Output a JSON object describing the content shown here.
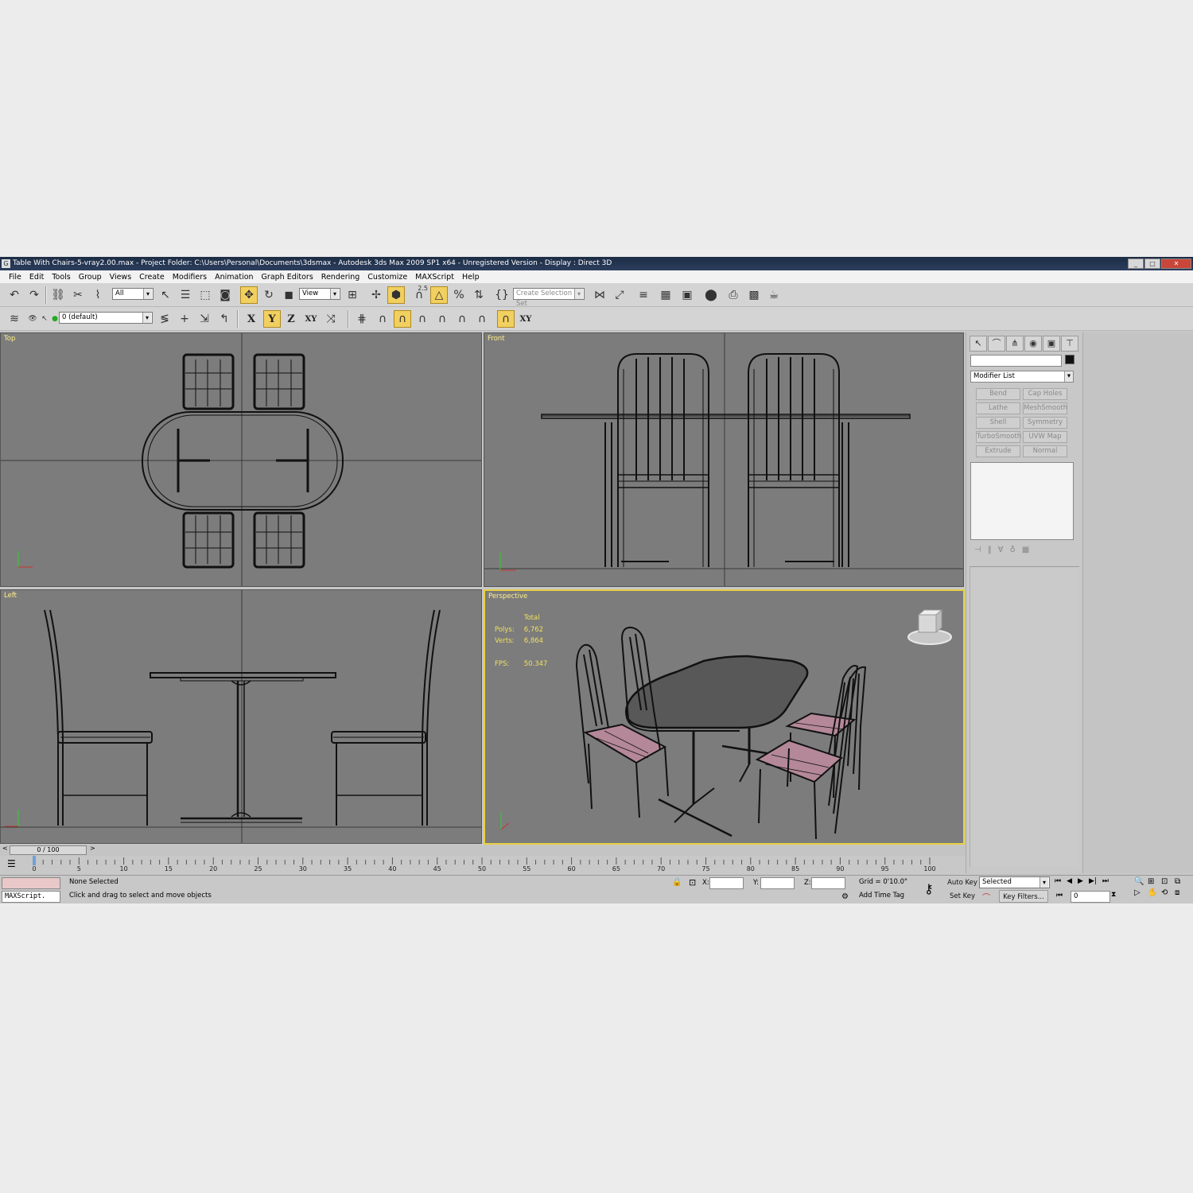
{
  "window": {
    "title": "Table With Chairs-5-vray2.00.max      - Project Folder: C:\\Users\\Personal\\Documents\\3dsmax      - Autodesk 3ds Max  2009 SP1  x64   - Unregistered Version      - Display : Direct 3D",
    "app_icon": "G",
    "minimize": "_",
    "maximize": "□",
    "close": "✕"
  },
  "menu": [
    "File",
    "Edit",
    "Tools",
    "Group",
    "Views",
    "Create",
    "Modifiers",
    "Animation",
    "Graph Editors",
    "Rendering",
    "Customize",
    "MAXScript",
    "Help"
  ],
  "toolbar": {
    "selection_filter": "All",
    "reference_coord": "View",
    "selection_set": "Create Selection Set",
    "snap_label": "2.5",
    "layer": "0 (default)",
    "axis": {
      "x": "X",
      "y": "Y",
      "z": "Z",
      "xy": "XY",
      "xy2": "XY"
    }
  },
  "viewports": {
    "top": {
      "label": "Top"
    },
    "front": {
      "label": "Front"
    },
    "left": {
      "label": "Left"
    },
    "perspective": {
      "label": "Perspective",
      "stats_header": "Total",
      "polys_label": "Polys:",
      "polys": "6,762",
      "verts_label": "Verts:",
      "verts": "6,864",
      "fps_label": "FPS:",
      "fps": "50.347"
    }
  },
  "command_panel": {
    "modifier_list": "Modifier List",
    "modifiers": [
      "Bend",
      "Cap Holes",
      "Lathe",
      "MeshSmooth",
      "Shell",
      "Symmetry",
      "TurboSmooth",
      "UVW Map",
      "Extrude",
      "Normal"
    ]
  },
  "timeline": {
    "frame": "0 / 100",
    "ticks": [
      "0",
      "5",
      "10",
      "15",
      "20",
      "25",
      "30",
      "35",
      "40",
      "45",
      "50",
      "55",
      "60",
      "65",
      "70",
      "75",
      "80",
      "85",
      "90",
      "95",
      "100"
    ]
  },
  "status": {
    "maxscript": "MAXScript.",
    "selection": "None Selected",
    "prompt": "Click and drag to select and move objects",
    "x_label": "X:",
    "y_label": "Y:",
    "z_label": "Z:",
    "grid": "Grid = 0'10.0\"",
    "add_time_tag": "Add Time Tag",
    "auto_key": "Auto Key",
    "set_key": "Set Key",
    "key_mode": "Selected",
    "key_filters": "Key Filters...",
    "current_frame": "0"
  },
  "colors": {
    "viewport_bg": "#7c7c7c",
    "active_border": "#e8d040",
    "label": "#ffef8a",
    "seat": "#b48898"
  }
}
